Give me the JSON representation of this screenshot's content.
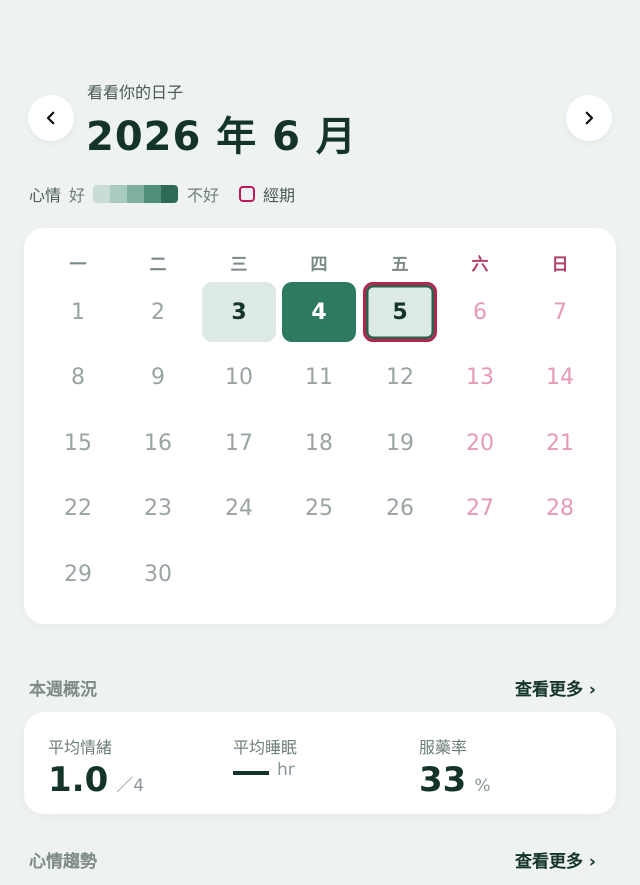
{
  "header": {
    "subtitle": "看看你的日子",
    "month_title": "2026 年 6 月"
  },
  "legend": {
    "mood_label": "心情",
    "good_label": "好",
    "bad_label": "不好",
    "period_label": "經期",
    "scale_colors": [
      "#c9ddd6",
      "#a9cbbf",
      "#7fb09e",
      "#4f8f79",
      "#2e6b57"
    ],
    "period_color": "#c2185b"
  },
  "calendar": {
    "weekdays": [
      "一",
      "二",
      "三",
      "四",
      "五",
      "六",
      "日"
    ],
    "days": [
      "1",
      "2",
      "3",
      "4",
      "5",
      "6",
      "7",
      "8",
      "9",
      "10",
      "11",
      "12",
      "13",
      "14",
      "15",
      "16",
      "17",
      "18",
      "19",
      "20",
      "21",
      "22",
      "23",
      "24",
      "25",
      "26",
      "27",
      "28",
      "29",
      "30"
    ],
    "logged_days": {
      "3": "mood-1",
      "4": "mood-4",
      "5": "today"
    }
  },
  "weekly": {
    "title": "本週概況",
    "see_more": "查看更多 ›",
    "avg_mood_label": "平均情緒",
    "avg_mood_value": "1.0",
    "avg_mood_unit": "／4",
    "avg_sleep_label": "平均睡眠",
    "avg_sleep_unit": "hr",
    "med_label": "服藥率",
    "med_value": "33",
    "med_unit": "%"
  },
  "trend": {
    "title": "心情趨勢",
    "see_more": "查看更多 ›"
  }
}
